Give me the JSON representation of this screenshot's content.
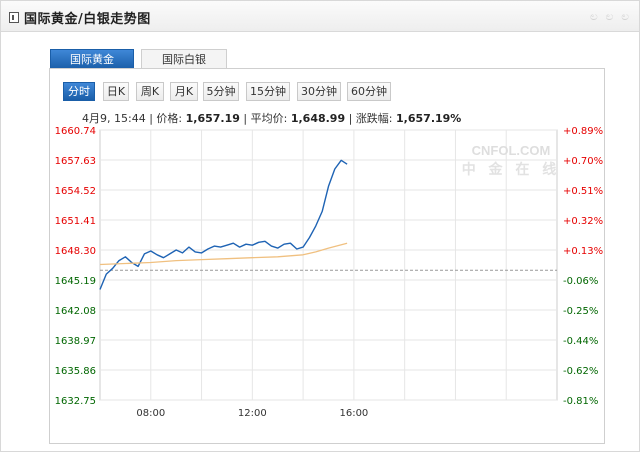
{
  "header": {
    "title": "国际黄金/白银走势图",
    "decoration": "ಲ ಲ ಲ"
  },
  "tabs": [
    {
      "label": "国际黄金",
      "active": true
    },
    {
      "label": "国际白银",
      "active": false
    }
  ],
  "periods": [
    {
      "label": "分时",
      "active": true
    },
    {
      "label": "日K",
      "active": false
    },
    {
      "label": "周K",
      "active": false
    },
    {
      "label": "月K",
      "active": false
    },
    {
      "label": "5分钟",
      "active": false
    },
    {
      "label": "15分钟",
      "active": false
    },
    {
      "label": "30分钟",
      "active": false
    },
    {
      "label": "60分钟",
      "active": false
    }
  ],
  "info": {
    "time": "4月9, 15:44",
    "price_label": "价格:",
    "price": "1,657.19",
    "avg_label": "平均价:",
    "avg": "1,648.99",
    "chg_label": "涨跌幅:",
    "chg": "1,657.19%"
  },
  "watermark": {
    "top": "CNFOL.COM",
    "bottom": "中 金 在 线"
  },
  "colors": {
    "price_line": "#1e63b4",
    "avg_line": "#f0c080",
    "up": "#e60000",
    "down": "#006600",
    "grid": "#e6e6e6",
    "baseline": "#999999",
    "accent": "#1a5ea8"
  },
  "chart_data": {
    "type": "line",
    "x_ticks": [
      "08:00",
      "12:00",
      "16:00"
    ],
    "y_ticks": [
      "1660.74",
      "1657.63",
      "1654.52",
      "1651.41",
      "1648.30",
      "1645.19",
      "1642.08",
      "1638.97",
      "1635.86",
      "1632.75"
    ],
    "y_tick_values": [
      1660.74,
      1657.63,
      1654.52,
      1651.41,
      1648.3,
      1645.19,
      1642.08,
      1638.97,
      1635.86,
      1632.75
    ],
    "pct_ticks": [
      "+0.89%",
      "+0.70%",
      "+0.51%",
      "+0.32%",
      "+0.13%",
      "-0.06%",
      "-0.25%",
      "-0.44%",
      "-0.62%",
      "-0.81%"
    ],
    "ylim": [
      1632.75,
      1660.74
    ],
    "reference_value": 1646.2,
    "series": [
      {
        "key": "price",
        "x": [
          "06:00",
          "06:15",
          "06:30",
          "06:45",
          "07:00",
          "07:15",
          "07:30",
          "07:45",
          "08:00",
          "08:15",
          "08:30",
          "08:45",
          "09:00",
          "09:15",
          "09:30",
          "09:45",
          "10:00",
          "10:15",
          "10:30",
          "10:45",
          "11:00",
          "11:15",
          "11:30",
          "11:45",
          "12:00",
          "12:15",
          "12:30",
          "12:45",
          "13:00",
          "13:15",
          "13:30",
          "13:45",
          "14:00",
          "14:15",
          "14:30",
          "14:45",
          "15:00",
          "15:15",
          "15:30",
          "15:44"
        ],
        "values": [
          1644.2,
          1645.8,
          1646.4,
          1647.2,
          1647.6,
          1647.0,
          1646.6,
          1647.9,
          1648.2,
          1647.8,
          1647.5,
          1647.9,
          1648.3,
          1648.0,
          1648.6,
          1648.1,
          1648.0,
          1648.4,
          1648.7,
          1648.6,
          1648.8,
          1649.0,
          1648.6,
          1648.9,
          1648.8,
          1649.1,
          1649.2,
          1648.7,
          1648.5,
          1648.9,
          1649.0,
          1648.4,
          1648.6,
          1649.6,
          1650.8,
          1652.3,
          1654.9,
          1656.7,
          1657.6,
          1657.19
        ]
      },
      {
        "key": "avg",
        "x": [
          "06:00",
          "07:00",
          "08:00",
          "09:00",
          "10:00",
          "11:00",
          "12:00",
          "13:00",
          "14:00",
          "14:30",
          "15:00",
          "15:44"
        ],
        "values": [
          1646.8,
          1646.9,
          1647.0,
          1647.2,
          1647.3,
          1647.4,
          1647.5,
          1647.6,
          1647.8,
          1648.1,
          1648.5,
          1648.99
        ]
      }
    ]
  }
}
